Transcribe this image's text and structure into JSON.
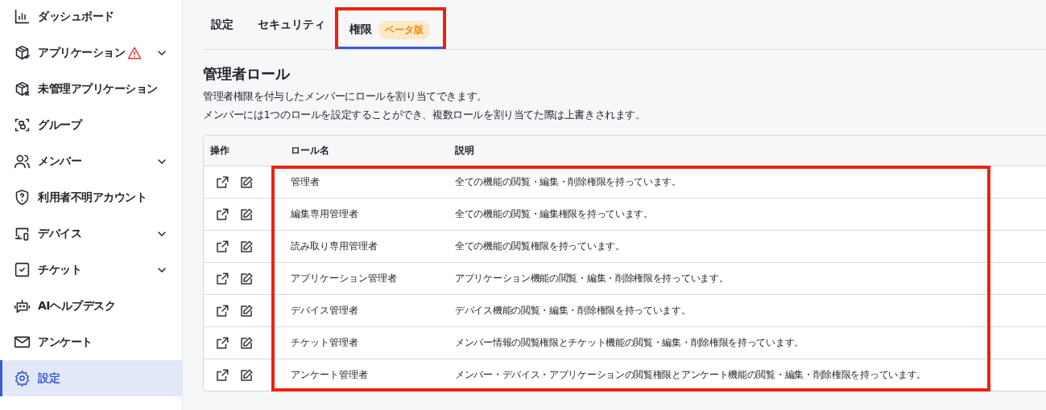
{
  "sidebar": {
    "items": [
      {
        "label": "ダッシュボード",
        "kind": "chart",
        "expandable": false,
        "warning": false,
        "selected": false
      },
      {
        "label": "アプリケーション",
        "kind": "box-check",
        "expandable": true,
        "warning": true,
        "selected": false
      },
      {
        "label": "未管理アプリケーション",
        "kind": "box-x",
        "expandable": false,
        "warning": false,
        "selected": false
      },
      {
        "label": "グループ",
        "kind": "group",
        "expandable": false,
        "warning": false,
        "selected": false
      },
      {
        "label": "メンバー",
        "kind": "users",
        "expandable": true,
        "warning": false,
        "selected": false
      },
      {
        "label": "利用者不明アカウント",
        "kind": "shield",
        "expandable": false,
        "warning": false,
        "selected": false
      },
      {
        "label": "デバイス",
        "kind": "device",
        "expandable": true,
        "warning": false,
        "selected": false
      },
      {
        "label": "チケット",
        "kind": "ticket",
        "expandable": true,
        "warning": false,
        "selected": false
      },
      {
        "label": "AIヘルプデスク",
        "kind": "bot",
        "expandable": false,
        "warning": false,
        "selected": false
      },
      {
        "label": "アンケート",
        "kind": "mail",
        "expandable": false,
        "warning": false,
        "selected": false
      },
      {
        "label": "設定",
        "kind": "gear",
        "expandable": false,
        "warning": false,
        "selected": true
      }
    ]
  },
  "tabs": [
    {
      "label": "設定",
      "selected": false,
      "highlighted": false
    },
    {
      "label": "セキュリティ",
      "selected": false,
      "highlighted": false
    },
    {
      "label": "権限",
      "badge": "ベータ版",
      "selected": true,
      "highlighted": true
    }
  ],
  "section": {
    "title": "管理者ロール",
    "description": [
      "管理者権限を付与したメンバーにロールを割り当てできます。",
      "メンバーには1つのロールを設定することができ、複数ロールを割り当てた際は上書きされます。"
    ]
  },
  "table": {
    "columns": [
      "操作",
      "ロール名",
      "説明"
    ],
    "rows_highlighted": true,
    "rows": [
      {
        "name": "管理者",
        "description": "全ての機能の閲覧・編集・削除権限を持っています。"
      },
      {
        "name": "編集専用管理者",
        "description": "全ての機能の閲覧・編集権限を持っています。"
      },
      {
        "name": "読み取り専用管理者",
        "description": "全ての機能の閲覧権限を持っています。"
      },
      {
        "name": "アプリケーション管理者",
        "description": "アプリケーション機能の閲覧・編集・削除権限を持っています。"
      },
      {
        "name": "デバイス管理者",
        "description": "デバイス機能の閲覧・編集・削除権限を持っています。"
      },
      {
        "name": "チケット管理者",
        "description": "メンバー情報の閲覧権限とチケット機能の閲覧・編集・削除権限を持っています。"
      },
      {
        "name": "アンケート管理者",
        "description": "メンバー・デバイス・アプリケーションの閲覧権限とアンケート機能の閲覧・編集・削除権限を持っています。"
      }
    ]
  }
}
